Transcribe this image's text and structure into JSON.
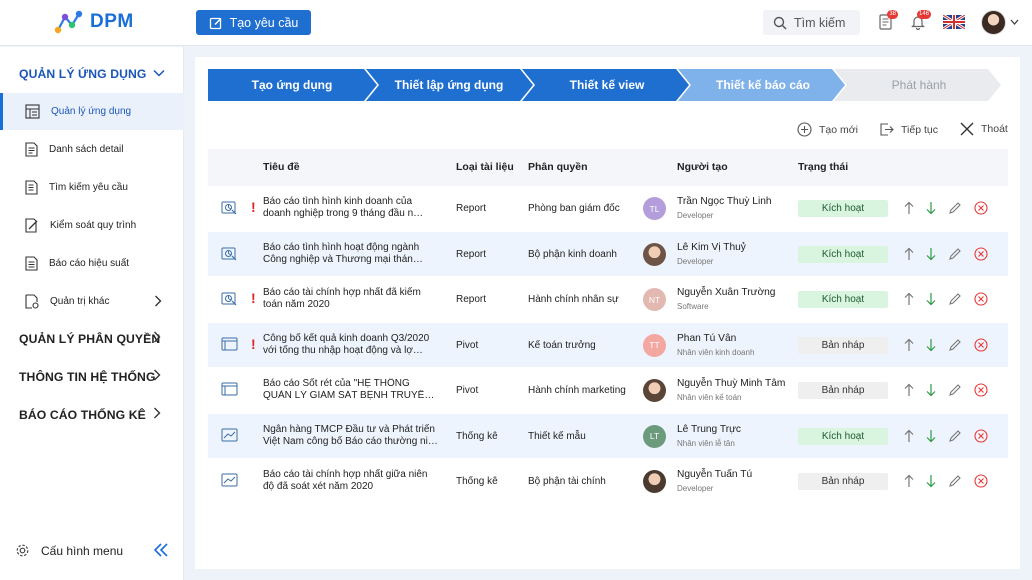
{
  "header": {
    "logo_text": "DPM",
    "create_button": "Tạo yêu cầu",
    "search_placeholder": "Tìm kiếm",
    "doc_badge": "38",
    "bell_badge": "146",
    "language_icon": "uk-flag-icon"
  },
  "sidebar": {
    "section_app": "QUẢN LÝ ỨNG DỤNG",
    "items": [
      {
        "label": "Quản lý ứng dụng",
        "icon": "app-manage-icon"
      },
      {
        "label": "Danh sách detail",
        "icon": "document-list-icon"
      },
      {
        "label": "Tìm kiếm yêu cầu",
        "icon": "search-doc-icon"
      },
      {
        "label": "Kiểm soát quy trình",
        "icon": "edit-doc-icon"
      },
      {
        "label": "Báo cáo hiệu suất",
        "icon": "report-icon"
      },
      {
        "label": "Quản trị khác",
        "icon": "settings-doc-icon"
      }
    ],
    "section_perm": "QUẢN LÝ PHÂN QUYỀN",
    "section_info": "THÔNG TIN HỆ THỐNG",
    "section_stats": "BÁO CÁO THỐNG KÊ",
    "footer_label": "Cấu hình menu"
  },
  "steps": [
    {
      "label": "Tạo ứng dụng",
      "state": "done"
    },
    {
      "label": "Thiết lập ứng dụng",
      "state": "done"
    },
    {
      "label": "Thiết kế view",
      "state": "done"
    },
    {
      "label": "Thiết kế báo cáo",
      "state": "current"
    },
    {
      "label": "Phát hành",
      "state": "pending"
    }
  ],
  "actions": {
    "new": "Tạo mới",
    "continue": "Tiếp tục",
    "exit": "Thoát"
  },
  "table": {
    "columns": [
      "Tiêu đề",
      "Loại tài liệu",
      "Phân quyền",
      "Người tạo",
      "Trạng thái"
    ],
    "rows": [
      {
        "icon": "report-chart-icon",
        "alert": true,
        "title1": "Báo cáo tình hình kinh doanh của",
        "title2": "doanh nghiệp trong 9 tháng đầu n…",
        "type": "Report",
        "perm": "Phòng ban giám đốc",
        "avatar": "TL",
        "avatar_color": "#b39ddb",
        "name": "Trần Ngọc Thuỳ Linh",
        "role": "Developer",
        "status": "Kích hoạt",
        "status_kind": "active"
      },
      {
        "icon": "report-chart-icon",
        "alert": false,
        "title1": "Báo cáo tình hình hoạt động ngành",
        "title2": "Công nghiệp và Thương mại thán…",
        "type": "Report",
        "perm": "Bộ phận kinh doanh",
        "avatar": "",
        "avatar_color": "#6d5446",
        "name": "Lê Kim Vị Thuỷ",
        "role": "Developer",
        "status": "Kích hoạt",
        "status_kind": "active"
      },
      {
        "icon": "report-chart-icon",
        "alert": true,
        "title1": "Báo cáo tài chính hợp nhất đã kiểm",
        "title2": "toán năm 2020",
        "type": "Report",
        "perm": "Hành chính nhân sự",
        "avatar": "NT",
        "avatar_color": "#e3b8b0",
        "name": "Nguyễn Xuân Trường",
        "role": "Software",
        "status": "Kích hoạt",
        "status_kind": "active"
      },
      {
        "icon": "pivot-icon",
        "alert": true,
        "title1": "Công bố kết quả kinh doanh Q3/2020",
        "title2": "với tổng thu nhập hoạt động và lợ…",
        "type": "Pivot",
        "perm": "Kế toán trưởng",
        "avatar": "TT",
        "avatar_color": "#f4a6a0",
        "name": "Phan Tú Vân",
        "role": "Nhân viên kinh doanh",
        "status": "Bản nháp",
        "status_kind": "draft"
      },
      {
        "icon": "pivot-icon",
        "alert": false,
        "title1": "Báo cáo Sốt rét của \"HỆ THỐNG",
        "title2": "QUẢN LÝ GIÁM SÁT BỆNH TRUYỀ…",
        "type": "Pivot",
        "perm": "Hành chính marketing",
        "avatar": "",
        "avatar_color": "#5a4438",
        "name": "Nguyễn Thuỳ Minh Tâm",
        "role": "Nhân viên kế toán",
        "status": "Bản nháp",
        "status_kind": "draft"
      },
      {
        "icon": "trend-chart-icon",
        "alert": false,
        "title1": "Ngân hàng TMCP Đầu tư và Phát triển",
        "title2": "Việt Nam công bố Báo cáo thường ni…",
        "type": "Thống kê",
        "perm": "Thiết kế mẫu",
        "avatar": "LT",
        "avatar_color": "#6b9a7c",
        "name": "Lê Trung Trực",
        "role": "Nhân viên lễ tân",
        "status": "Kích hoạt",
        "status_kind": "active"
      },
      {
        "icon": "trend-chart-icon",
        "alert": false,
        "title1": "Báo cáo tài chính hợp nhất giữa niên",
        "title2": "độ đã soát xét năm 2020",
        "type": "Thống kê",
        "perm": "Bộ phận tài chính",
        "avatar": "",
        "avatar_color": "#4a3a30",
        "name": "Nguyễn Tuấn Tú",
        "role": "Developer",
        "status": "Bản nháp",
        "status_kind": "draft"
      }
    ]
  }
}
